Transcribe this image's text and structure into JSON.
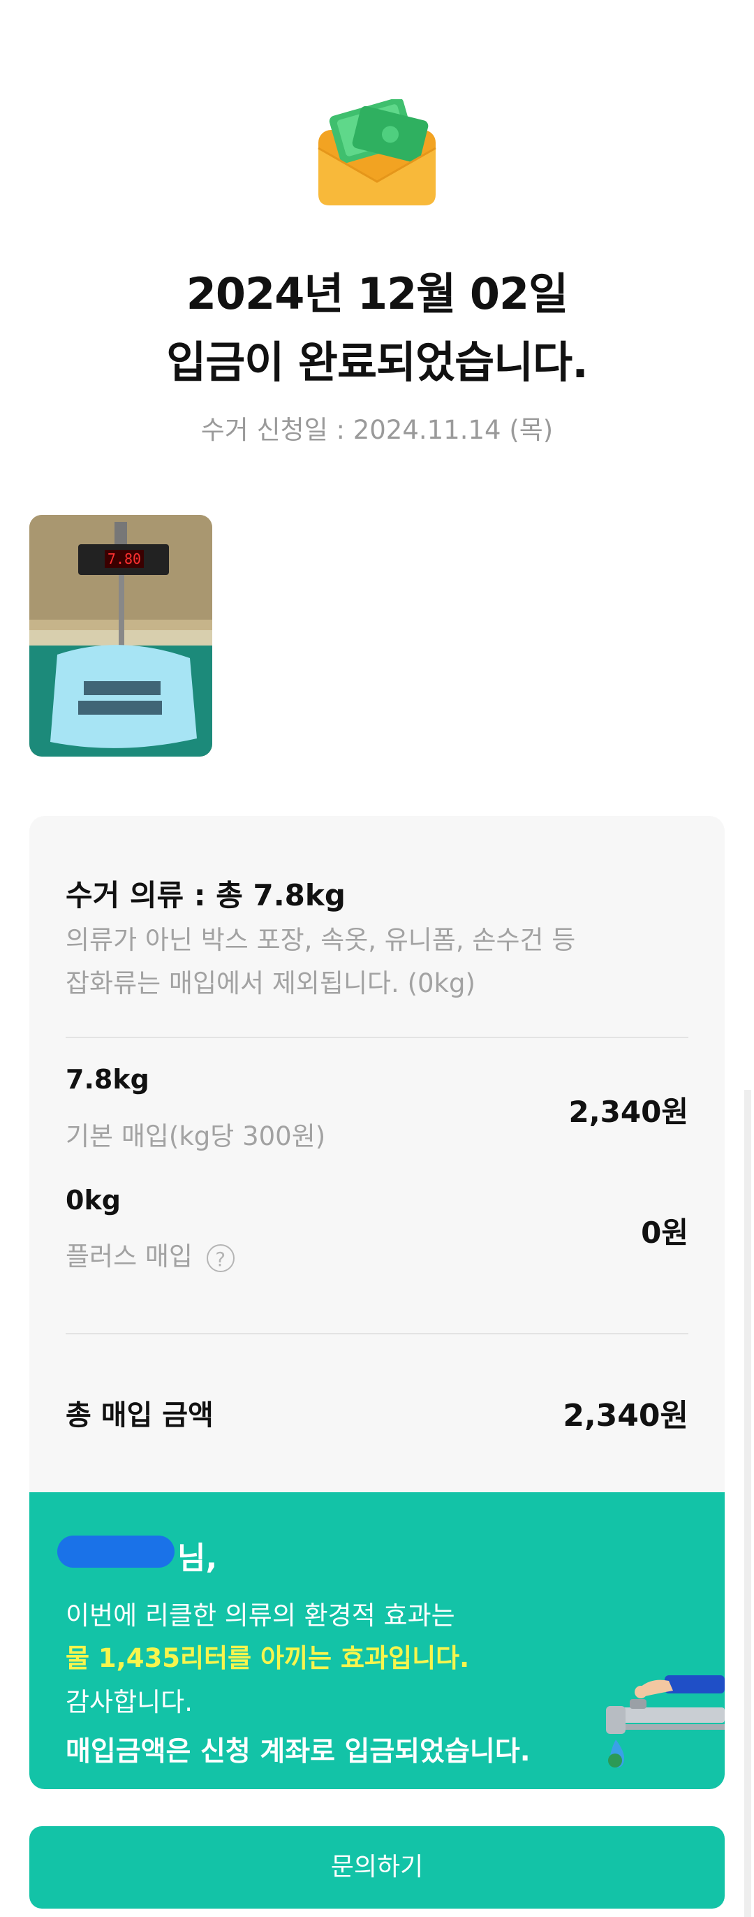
{
  "header": {
    "title_line1": "2024년 12월 02일",
    "title_line2": "입금이 완료되었습니다.",
    "request_date": "수거 신청일 : 2024.11.14 (목)"
  },
  "photo": {
    "scale_display": "7.80"
  },
  "summary": {
    "title": "수거 의류 : 총 7.8kg",
    "note_line1": "의류가 아닌 박스 포장, 속옷, 유니폼, 손수건 등",
    "note_line2": "잡화류는 매입에서 제외됩니다. (0kg)",
    "rows": [
      {
        "weight": "7.8kg",
        "desc": "기본 매입(kg당 300원)",
        "amount": "2,340원"
      },
      {
        "weight": "0kg",
        "desc": "플러스 매입",
        "amount": "0원"
      }
    ],
    "help_symbol": "?",
    "total_label": "총 매입 금액",
    "total_amount": "2,340원"
  },
  "impact": {
    "name_suffix": "님,",
    "line1": "이번에 리클한 의류의 환경적 효과는",
    "line2": "물 1,435리터를 아끼는 효과입니다.",
    "line3": "감사합니다.",
    "line4": "매입금액은 신청 계좌로 입금되었습니다."
  },
  "cta": {
    "label": "문의하기"
  },
  "colors": {
    "accent": "#13c3a7",
    "highlight": "#f7f54d",
    "redaction": "#1a72e8"
  },
  "icons": [
    "money-envelope-icon",
    "question-circle-icon",
    "faucet-icon"
  ]
}
